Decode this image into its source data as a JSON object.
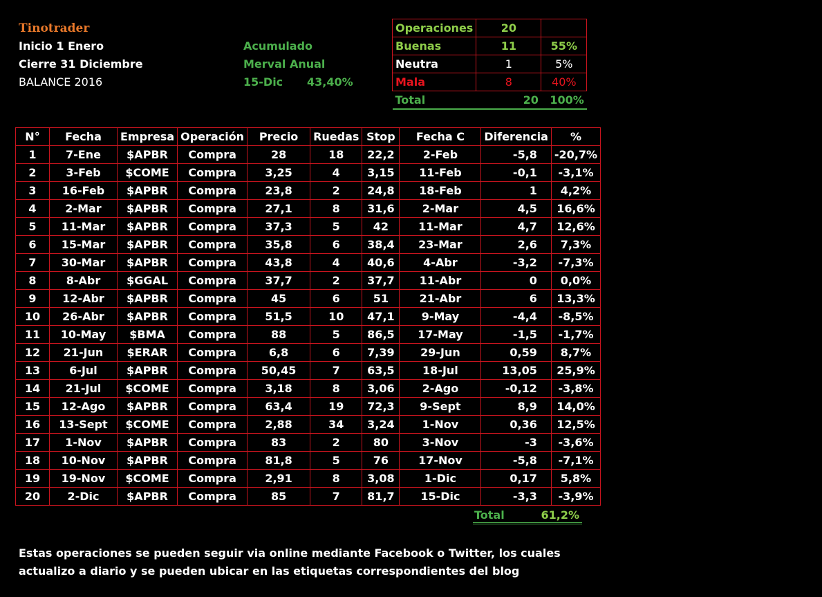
{
  "header": {
    "brand": "Tinotrader",
    "line1": "Inicio 1 Enero",
    "line2": "Cierre 31 Diciembre",
    "line3": "BALANCE 2016",
    "acum_label": "Acumulado",
    "merval_label": "Merval Anual",
    "merval_date": "15-Dic",
    "merval_value": "43,40%"
  },
  "summary": {
    "operaciones": {
      "label": "Operaciones",
      "count": "20",
      "pct": ""
    },
    "buenas": {
      "label": "Buenas",
      "count": "11",
      "pct": "55%"
    },
    "neutra": {
      "label": "Neutra",
      "count": "1",
      "pct": "5%"
    },
    "mala": {
      "label": "Mala",
      "count": "8",
      "pct": "40%"
    },
    "total": {
      "label": "Total",
      "count": "20",
      "pct": "100%"
    }
  },
  "table": {
    "headers": [
      "N°",
      "Fecha",
      "Empresa",
      "Operación",
      "Precio",
      "Ruedas",
      "Stop",
      "Fecha C",
      "Diferencia",
      "%"
    ],
    "rows": [
      [
        "1",
        "7-Ene",
        "$APBR",
        "Compra",
        "28",
        "18",
        "22,2",
        "2-Feb",
        "-5,8",
        "-20,7%"
      ],
      [
        "2",
        "3-Feb",
        "$COME",
        "Compra",
        "3,25",
        "4",
        "3,15",
        "11-Feb",
        "-0,1",
        "-3,1%"
      ],
      [
        "3",
        "16-Feb",
        "$APBR",
        "Compra",
        "23,8",
        "2",
        "24,8",
        "18-Feb",
        "1",
        "4,2%"
      ],
      [
        "4",
        "2-Mar",
        "$APBR",
        "Compra",
        "27,1",
        "8",
        "31,6",
        "2-Mar",
        "4,5",
        "16,6%"
      ],
      [
        "5",
        "11-Mar",
        "$APBR",
        "Compra",
        "37,3",
        "5",
        "42",
        "11-Mar",
        "4,7",
        "12,6%"
      ],
      [
        "6",
        "15-Mar",
        "$APBR",
        "Compra",
        "35,8",
        "6",
        "38,4",
        "23-Mar",
        "2,6",
        "7,3%"
      ],
      [
        "7",
        "30-Mar",
        "$APBR",
        "Compra",
        "43,8",
        "4",
        "40,6",
        "4-Abr",
        "-3,2",
        "-7,3%"
      ],
      [
        "8",
        "8-Abr",
        "$GGAL",
        "Compra",
        "37,7",
        "2",
        "37,7",
        "11-Abr",
        "0",
        "0,0%"
      ],
      [
        "9",
        "12-Abr",
        "$APBR",
        "Compra",
        "45",
        "6",
        "51",
        "21-Abr",
        "6",
        "13,3%"
      ],
      [
        "10",
        "26-Abr",
        "$APBR",
        "Compra",
        "51,5",
        "10",
        "47,1",
        "9-May",
        "-4,4",
        "-8,5%"
      ],
      [
        "11",
        "10-May",
        "$BMA",
        "Compra",
        "88",
        "5",
        "86,5",
        "17-May",
        "-1,5",
        "-1,7%"
      ],
      [
        "12",
        "21-Jun",
        "$ERAR",
        "Compra",
        "6,8",
        "6",
        "7,39",
        "29-Jun",
        "0,59",
        "8,7%"
      ],
      [
        "13",
        "6-Jul",
        "$APBR",
        "Compra",
        "50,45",
        "7",
        "63,5",
        "18-Jul",
        "13,05",
        "25,9%"
      ],
      [
        "14",
        "21-Jul",
        "$COME",
        "Compra",
        "3,18",
        "8",
        "3,06",
        "2-Ago",
        "-0,12",
        "-3,8%"
      ],
      [
        "15",
        "12-Ago",
        "$APBR",
        "Compra",
        "63,4",
        "19",
        "72,3",
        "9-Sept",
        "8,9",
        "14,0%"
      ],
      [
        "16",
        "13-Sept",
        "$COME",
        "Compra",
        "2,88",
        "34",
        "3,24",
        "1-Nov",
        "0,36",
        "12,5%"
      ],
      [
        "17",
        "1-Nov",
        "$APBR",
        "Compra",
        "83",
        "2",
        "80",
        "3-Nov",
        "-3",
        "-3,6%"
      ],
      [
        "18",
        "10-Nov",
        "$APBR",
        "Compra",
        "81,8",
        "5",
        "76",
        "17-Nov",
        "-5,8",
        "-7,1%"
      ],
      [
        "19",
        "19-Nov",
        "$COME",
        "Compra",
        "2,91",
        "8",
        "3,08",
        "1-Dic",
        "0,17",
        "5,8%"
      ],
      [
        "20",
        "2-Dic",
        "$APBR",
        "Compra",
        "85",
        "7",
        "81,7",
        "15-Dic",
        "-3,3",
        "-3,9%"
      ]
    ],
    "total_label": "Total",
    "total_value": "61,2%"
  },
  "note": "Estas operaciones se pueden seguir via online mediante Facebook o Twitter, los cuales actualizo a diario y se pueden ubicar en las etiquetas correspondientes del blog",
  "colors": {
    "background": "#000000",
    "border": "#c8141e",
    "green": "#4cb04c",
    "light_green": "#8fce4a",
    "red": "#e8141e",
    "brand": "#e8782a"
  }
}
